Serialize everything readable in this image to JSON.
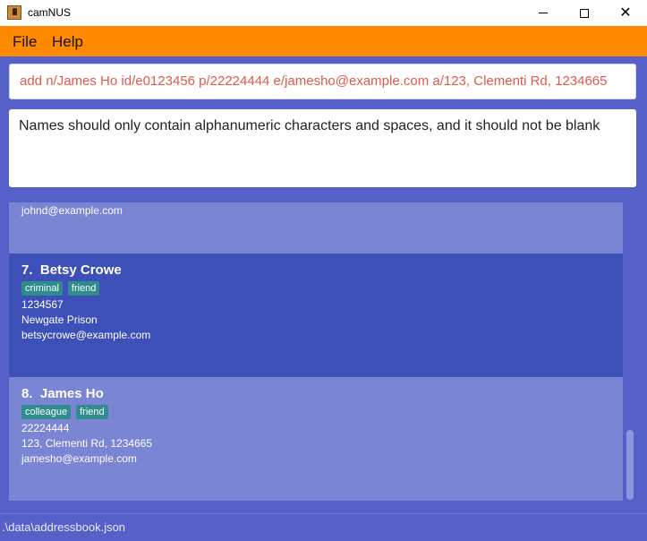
{
  "window": {
    "title": "camNUS"
  },
  "menu": {
    "file": "File",
    "help": "Help"
  },
  "command": {
    "value": "add n/James Ho id/e0123456 p/22224444 e/jamesho@example.com a/123, Clementi Rd, 1234665"
  },
  "result": {
    "message": "Names should only contain alphanumeric characters and spaces, and it should not be blank"
  },
  "persons": [
    {
      "email": "johnd@example.com"
    },
    {
      "index": "7.",
      "name": "Betsy Crowe",
      "tags": [
        "criminal",
        "friend"
      ],
      "phone": "1234567",
      "address": "Newgate Prison",
      "email": "betsycrowe@example.com"
    },
    {
      "index": "8.",
      "name": "James Ho",
      "tags": [
        "colleague",
        "friend"
      ],
      "phone": "22224444",
      "address": "123, Clementi Rd, 1234665",
      "email": "jamesho@example.com"
    }
  ],
  "status": {
    "file_path": ".\\data\\addressbook.json"
  },
  "colors": {
    "menu_bar": "#ff8a00",
    "background": "#5561c8",
    "card_light": "#7a85d4",
    "card_selected": "#3d50b8",
    "tag": "#2e8c8c",
    "command_text": "#e05a4a"
  }
}
